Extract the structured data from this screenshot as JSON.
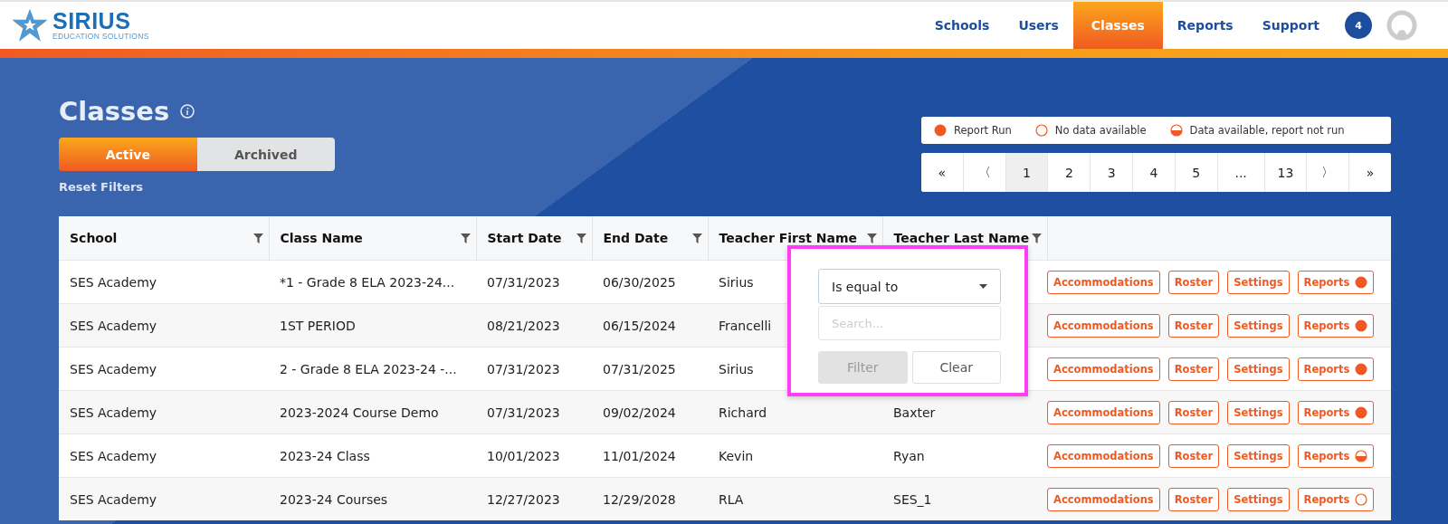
{
  "logo": {
    "name": "SIRIUS",
    "tagline": "EDUCATION SOLUTIONS"
  },
  "nav": [
    {
      "label": "Schools",
      "selected": false
    },
    {
      "label": "Users",
      "selected": false
    },
    {
      "label": "Classes",
      "selected": true
    },
    {
      "label": "Reports",
      "selected": false
    },
    {
      "label": "Support",
      "selected": false
    }
  ],
  "notifications": {
    "count": "4"
  },
  "page": {
    "title": "Classes"
  },
  "status_tabs": [
    {
      "label": "Active",
      "selected": true
    },
    {
      "label": "Archived",
      "selected": false
    }
  ],
  "reset_filters": "Reset Filters",
  "legend": [
    {
      "kind": "run",
      "label": "Report Run"
    },
    {
      "kind": "none",
      "label": "No data available"
    },
    {
      "kind": "partial",
      "label": "Data available, report not run"
    }
  ],
  "pagination": [
    {
      "label": "«",
      "selected": false
    },
    {
      "label": "〈",
      "selected": false
    },
    {
      "label": "1",
      "selected": true
    },
    {
      "label": "2",
      "selected": false
    },
    {
      "label": "3",
      "selected": false
    },
    {
      "label": "4",
      "selected": false
    },
    {
      "label": "5",
      "selected": false
    },
    {
      "label": "...",
      "selected": false
    },
    {
      "label": "13",
      "selected": false
    },
    {
      "label": "〉",
      "selected": false
    },
    {
      "label": "»",
      "selected": false
    }
  ],
  "table": {
    "columns": [
      "School",
      "Class Name",
      "Start Date",
      "End Date",
      "Teacher First Name",
      "Teacher Last Name"
    ],
    "rows": [
      {
        "cells": [
          "SES Academy",
          "*1 - Grade 8 ELA 2023-24...",
          "07/31/2023",
          "06/30/2025",
          "Sirius"
        ],
        "actions": [
          "Accommodations",
          "Roster",
          "Settings",
          "Reports"
        ],
        "kind": "run"
      },
      {
        "cells": [
          "SES Academy",
          "1ST PERIOD",
          "08/21/2023",
          "06/15/2024",
          "Francelli"
        ],
        "actions": [
          "Accommodations",
          "Roster",
          "Settings",
          "Reports"
        ],
        "kind": "run"
      },
      {
        "cells": [
          "SES Academy",
          "2 - Grade 8 ELA 2023-24 -...",
          "07/31/2023",
          "07/31/2025",
          "Sirius"
        ],
        "actions": [
          "Accommodations",
          "Roster",
          "Settings",
          "Reports"
        ],
        "kind": "run"
      },
      {
        "cells": [
          "SES Academy",
          "2023-2024 Course Demo",
          "07/31/2023",
          "09/02/2024",
          "Richard",
          "Baxter"
        ],
        "actions": [
          "Accommodations",
          "Roster",
          "Settings",
          "Reports"
        ],
        "kind": "run"
      },
      {
        "cells": [
          "SES Academy",
          "2023-24 Class",
          "10/01/2023",
          "11/01/2024",
          "Kevin",
          "Ryan"
        ],
        "actions": [
          "Accommodations",
          "Roster",
          "Settings",
          "Reports"
        ],
        "kind": "partial"
      },
      {
        "cells": [
          "SES Academy",
          "2023-24 Courses",
          "12/27/2023",
          "12/29/2028",
          "RLA",
          "SES_1"
        ],
        "actions": [
          "Accommodations",
          "Roster",
          "Settings",
          "Reports"
        ],
        "kind": "none"
      }
    ]
  },
  "filter_popup": {
    "operator": "Is equal to",
    "placeholder": "Search...",
    "buttons": [
      {
        "label": "Filter",
        "disabled": true
      },
      {
        "label": "Clear",
        "disabled": false
      }
    ]
  }
}
